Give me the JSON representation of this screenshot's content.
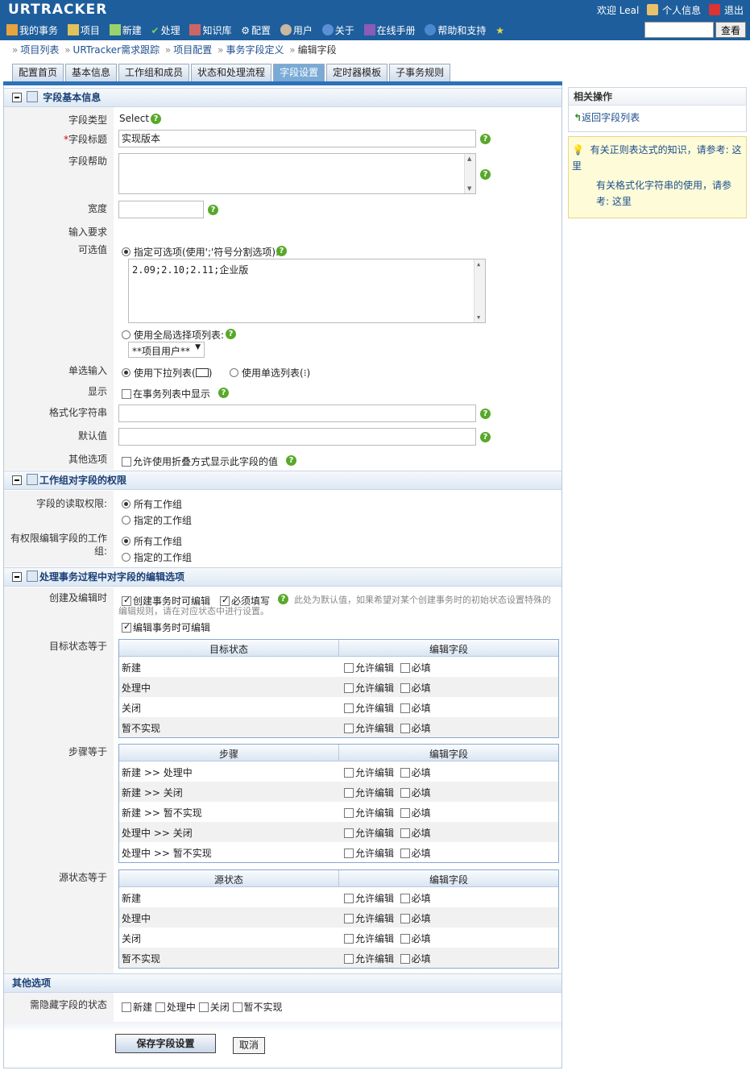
{
  "header": {
    "logo": "URTRACKER",
    "welcome": "欢迎 Leal",
    "profile": "个人信息",
    "logout": "退出",
    "nav": [
      "我的事务",
      "项目",
      "新建",
      "处理",
      "知识库",
      "配置",
      "用户",
      "关于",
      "在线手册",
      "帮助和支持"
    ],
    "search_button": "查看"
  },
  "breadcrumb": [
    "项目列表",
    "URTracker需求跟踪",
    "项目配置",
    "事务字段定义",
    "编辑字段"
  ],
  "tabs": [
    "配置首页",
    "基本信息",
    "工作组和成员",
    "状态和处理流程",
    "字段设置",
    "定时器模板",
    "子事务规则"
  ],
  "active_tab": "字段设置",
  "sec1": {
    "title": "字段基本信息",
    "type_label": "字段类型",
    "type_value": "Select",
    "title_label": "字段标题",
    "title_value": "实现版本",
    "help_label": "字段帮助",
    "width_label": "宽度",
    "input_req_label": "输入要求",
    "options_label": "可选值",
    "opt_specified": "指定可选项(使用';'符号分割选项):",
    "opt_values": "2.09;2.10;2.11;企业版",
    "opt_global": "使用全局选择项列表:",
    "opt_global_value": "**项目用户**",
    "single_label": "单选输入",
    "single_dropdown": "使用下拉列表(",
    "single_radio": "使用单选列表(",
    "display_label": "显示",
    "display_check": "在事务列表中显示",
    "format_label": "格式化字符串",
    "default_label": "默认值",
    "other_label": "其他选项",
    "other_check": "允许使用折叠方式显示此字段的值"
  },
  "sec2": {
    "title": "工作组对字段的权限",
    "read_label": "字段的读取权限:",
    "edit_label": "有权限编辑字段的工作组:",
    "all_groups": "所有工作组",
    "spec_groups": "指定的工作组"
  },
  "sec3": {
    "title": "处理事务过程中对字段的编辑选项",
    "create_label": "创建及编辑时",
    "create_editable": "创建事务时可编辑",
    "required": "必须填写",
    "note": "此处为默认值，如果希望对某个创建事务时的初始状态设置特殊的编辑规则，请在对应状态中进行设置。",
    "edit_editable": "编辑事务时可编辑",
    "allow_edit": "允许编辑",
    "must": "必填",
    "edit_col": "编辑字段",
    "target_label": "目标状态等于",
    "target_col": "目标状态",
    "target_rows": [
      "新建",
      "处理中",
      "关闭",
      "暂不实现"
    ],
    "step_label": "步骤等于",
    "step_col": "步骤",
    "step_rows": [
      "新建 >> 处理中",
      "新建 >> 关闭",
      "新建 >> 暂不实现",
      "处理中 >> 关闭",
      "处理中 >> 暂不实现"
    ],
    "source_label": "源状态等于",
    "source_col": "源状态",
    "source_rows": [
      "新建",
      "处理中",
      "关闭",
      "暂不实现"
    ]
  },
  "sec4": {
    "title": "其他选项",
    "hide_label": "需隐藏字段的状态",
    "hide_states": [
      "新建",
      "处理中",
      "关闭",
      "暂不实现"
    ]
  },
  "buttons": {
    "save": "保存字段设置",
    "cancel": "取消"
  },
  "side": {
    "related_title": "相关操作",
    "back_link": "返回字段列表",
    "tip1": "有关正则表达式的知识，请参考:",
    "tip2": "有关格式化字符串的使用，请参考:",
    "here": "这里"
  }
}
